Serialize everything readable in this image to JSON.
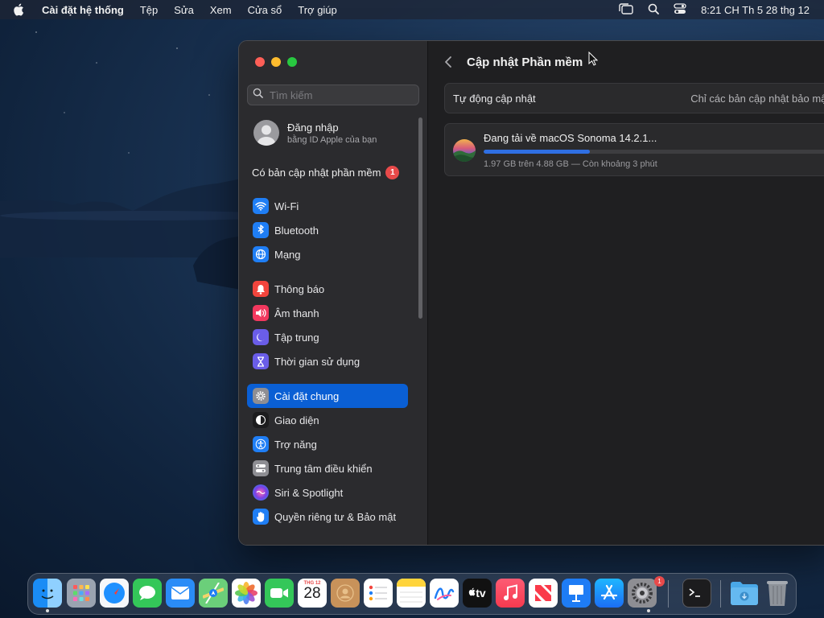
{
  "menubar": {
    "app_name": "Cài đặt hệ thống",
    "items": [
      "Tệp",
      "Sửa",
      "Xem",
      "Cửa sổ",
      "Trợ giúp"
    ],
    "clock": "8:21 CH Th 5 28 thg 12"
  },
  "sidebar": {
    "search_placeholder": "Tìm kiếm",
    "account": {
      "title": "Đăng nhập",
      "subtitle": "bằng ID Apple của bạn"
    },
    "update_label": "Có bản cập nhật phần mềm",
    "update_count": "1",
    "groups": [
      [
        {
          "label": "Wi‑Fi",
          "icon": "wifi-icon",
          "color": "#1f7ef5"
        },
        {
          "label": "Bluetooth",
          "icon": "bluetooth-icon",
          "color": "#1f7ef5"
        },
        {
          "label": "Mạng",
          "icon": "globe-icon",
          "color": "#1f7ef5"
        }
      ],
      [
        {
          "label": "Thông báo",
          "icon": "bell-icon",
          "color": "#f2453d"
        },
        {
          "label": "Âm thanh",
          "icon": "speaker-icon",
          "color": "#f2385e"
        },
        {
          "label": "Tập trung",
          "icon": "moon-icon",
          "color": "#6a5de8"
        },
        {
          "label": "Thời gian sử dụng",
          "icon": "hourglass-icon",
          "color": "#6a5de8"
        }
      ],
      [
        {
          "label": "Cài đặt chung",
          "icon": "gear-icon",
          "color": "#8e8e93",
          "selected": true
        },
        {
          "label": "Giao diện",
          "icon": "appearance-icon",
          "color": "#1c1c1e"
        },
        {
          "label": "Trợ năng",
          "icon": "accessibility-icon",
          "color": "#1f7ef5"
        },
        {
          "label": "Trung tâm điều khiển",
          "icon": "control-center-icon",
          "color": "#8e8e93"
        },
        {
          "label": "Siri & Spotlight",
          "icon": "siri-icon",
          "color": "#7b3fe4"
        },
        {
          "label": "Quyền riêng tư & Bảo mật",
          "icon": "hand-icon",
          "color": "#1f7ef5"
        }
      ]
    ]
  },
  "content": {
    "title": "Cập nhật Phần mềm",
    "auto_update": {
      "label": "Tự động cập nhật",
      "value": "Chỉ các bản cập nhật bảo mật"
    },
    "download": {
      "title": "Đang tải về macOS Sonoma 14.2.1...",
      "status": "1.97 GB trên 4.88 GB — Còn khoảng 3 phút",
      "progress_percent": 30
    }
  },
  "dock": {
    "apps": [
      "Finder",
      "Launchpad",
      "Safari",
      "Messages",
      "Mail",
      "Maps",
      "Photos",
      "FaceTime",
      "Calendar",
      "Contacts",
      "Reminders",
      "Notes",
      "Freeform",
      "TV",
      "Music",
      "News",
      "Keynote",
      "App Store",
      "System Settings",
      "Terminal",
      "Downloads",
      "Trash"
    ],
    "calendar_month": "THG 12",
    "calendar_day": "28",
    "tv_label": "tv",
    "settings_badge": "1"
  }
}
